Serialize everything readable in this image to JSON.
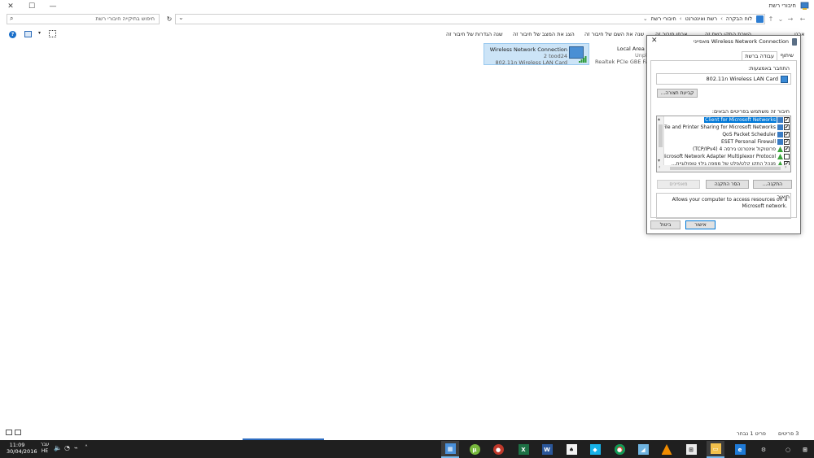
{
  "window": {
    "title": "חיבורי רשת"
  },
  "address": {
    "crumbs": [
      "לוח הבקרה",
      "רשת ואינטרנט",
      "חיבורי רשת"
    ],
    "search_placeholder": "חיפוש בתיקייה חיבורי רשת"
  },
  "commands": [
    "שנה הגדרות של חיבור זה",
    "הצג את המצב של חיבור זה",
    "שנה את השם של חיבור זה",
    "אבחן חיבור זה",
    "השבת התקן רשת זה",
    "ארגן"
  ],
  "adapters": {
    "wireless": {
      "name": "Wireless Network Connection",
      "network": "2 tood24",
      "device": "802.11n Wireless LAN Card"
    },
    "lan": {
      "name": "Local Area C",
      "status": "Unplug",
      "device": "Realtek PCIe GBE Famil"
    }
  },
  "dialog": {
    "title": "Wireless Network Connection מאפייני",
    "tabs": {
      "networking": "עבודה ברשת",
      "sharing": "שיתוף"
    },
    "connect_using_label": "התחבר באמצעות:",
    "adapter": "802.11n Wireless LAN Card",
    "configure_button": "קביעת תצורה...",
    "items_label": "חיבור זה משתמש בפריטים הבאים:",
    "items": [
      {
        "label": "Client for Microsoft Networks",
        "checked": true,
        "selected": true,
        "icon": "network-client-icon"
      },
      {
        "label": "File and Printer Sharing for Microsoft Networks",
        "checked": true,
        "selected": false,
        "icon": "network-service-icon"
      },
      {
        "label": "QoS Packet Scheduler",
        "checked": true,
        "selected": false,
        "icon": "network-service-icon"
      },
      {
        "label": "ESET Personal Firewall",
        "checked": true,
        "selected": false,
        "icon": "network-service-icon"
      },
      {
        "label": "פרוטוקול אינטרנט גירסה 4 (TCP/IPv4)",
        "checked": true,
        "selected": false,
        "icon": "protocol-icon"
      },
      {
        "label": "Microsoft Network Adapter Multiplexor Protocol",
        "checked": false,
        "selected": false,
        "icon": "protocol-icon"
      },
      {
        "label": "מנהל התקן קלט/פלט של ממפה גילוי טופולוגיית...",
        "checked": true,
        "selected": false,
        "icon": "protocol-icon"
      }
    ],
    "install_button": "התקנה...",
    "uninstall_button": "הסר התקנה",
    "properties_button": "מאפיינים",
    "description_label": "תיאור",
    "description": "Allows your computer to access resources on a Microsoft network.",
    "ok_button": "אישור",
    "cancel_button": "ביטול"
  },
  "statusbar": {
    "items_count": "3 פריטים",
    "selected_count": "פריט 1 נבחר"
  },
  "taskbar": {
    "time": "11:09",
    "date": "30/04/2016",
    "lang_top": "עבר",
    "lang_bottom": "HE",
    "apps": [
      "task-view-icon",
      "utorrent-icon",
      "record-icon",
      "excel-icon",
      "word-icon",
      "cards-icon",
      "kodi-icon",
      "chrome-icon",
      "paint-icon",
      "vlc-icon",
      "store-icon",
      "explorer-icon",
      "edge-icon",
      "settings-icon",
      "start-icon"
    ]
  },
  "colors": {
    "selection": "#0078d7",
    "adapter_selected_bg": "#cce4f7",
    "taskbar": "#1f1f1f"
  }
}
